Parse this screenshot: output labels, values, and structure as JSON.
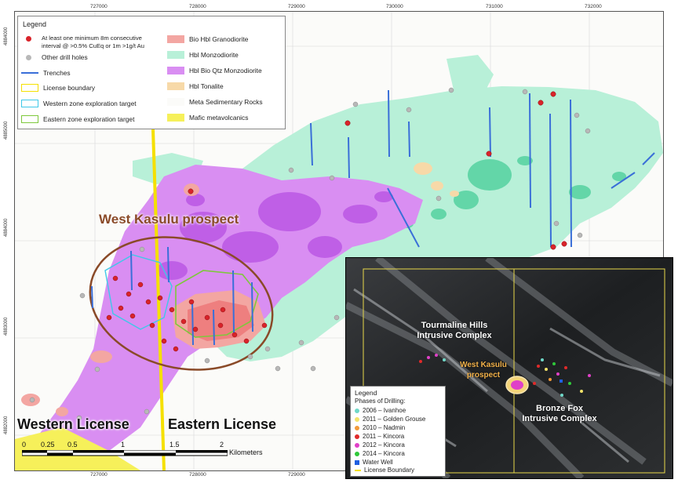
{
  "map_axes": {
    "top_ticks": [
      "727000",
      "728000",
      "729000",
      "730000",
      "731000",
      "732000"
    ],
    "bottom_ticks": [
      "727000",
      "728000",
      "729000"
    ],
    "left_ticks": [
      "4884000",
      "4885000",
      "4884000",
      "4883000",
      "4882000"
    ]
  },
  "legend": {
    "title": "Legend",
    "items_left": [
      {
        "label": "At least one minimum 8m consecutive interval @ >0.5% CuEq or 1m >1g/t Au",
        "symbol": "red-dot",
        "color": "#d9232a"
      },
      {
        "label": "Other drill holes",
        "symbol": "grey-dot",
        "color": "#b8b8b8"
      },
      {
        "label": "Trenches",
        "symbol": "blue-line",
        "color": "#3a6fd8"
      },
      {
        "label": "License boundary",
        "symbol": "yellow-box",
        "color": "#f5e000"
      },
      {
        "label": "Western zone exploration target",
        "symbol": "cyan-box",
        "color": "#3fc8e8"
      },
      {
        "label": "Eastern zone exploration target",
        "symbol": "green-box",
        "color": "#7ec83c"
      }
    ],
    "items_right": [
      {
        "label": "Bio Hbl Granodiorite",
        "color": "#f3a6a2"
      },
      {
        "label": "Hbl Monzodiorite",
        "color": "#b8f0d8"
      },
      {
        "label": "Hbl Bio Qtz Monzodiorite",
        "color": "#d98ef2"
      },
      {
        "label": "Hbl Tonalite",
        "color": "#f7d9a8"
      },
      {
        "label": "Meta Sedimentary Rocks",
        "color": "#fbfbf9"
      },
      {
        "label": "Mafic metavolcanics",
        "color": "#f6f05a"
      }
    ]
  },
  "map_labels": {
    "prospect": "West Kasulu prospect",
    "western_license": "Western License",
    "eastern_license": "Eastern License"
  },
  "scalebar": {
    "ticks": [
      "0",
      "0.25",
      "0.5",
      "1",
      "1.5",
      "2"
    ],
    "unit": "Kilometers"
  },
  "inset": {
    "labels": {
      "tourmaline": "Tourmaline Hills\nIntrusive Complex",
      "west_kasulu": "West Kasulu\nprospect",
      "bronze_fox": "Bronze Fox\nIntrusive Complex"
    },
    "legend": {
      "title": "Legend",
      "subtitle": "Phases of Drilling:",
      "items": [
        {
          "label": "2006 – Ivanhoe",
          "color": "#6fd8c8"
        },
        {
          "label": "2011 – Golden Grouse",
          "color": "#f3e36a"
        },
        {
          "label": "2010 – Nadmin",
          "color": "#f39a3a"
        },
        {
          "label": "2011 – Kincora",
          "color": "#e02a2a"
        },
        {
          "label": "2012 – Kincora",
          "color": "#e040c8"
        },
        {
          "label": "2014 – Kincora",
          "color": "#2fc83a"
        },
        {
          "label": "Water Well",
          "color": "#2060e0",
          "shape": "square"
        },
        {
          "label": "License Boundary",
          "color": "#f5e000",
          "shape": "line"
        }
      ]
    }
  }
}
